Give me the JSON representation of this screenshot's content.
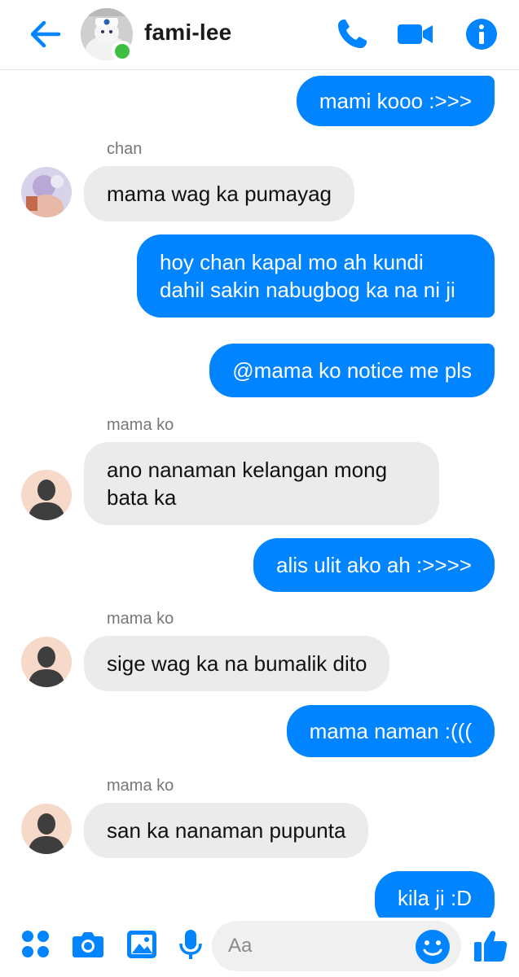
{
  "header": {
    "title": "fami-lee",
    "back_icon": "arrow-left-icon",
    "call_icon": "phone-icon",
    "video_icon": "video-camera-icon",
    "info_icon": "info-icon",
    "accent_color": "#0084ff",
    "online_color": "#3fbf3f"
  },
  "messages": [
    {
      "type": "out",
      "text": "mami kooo :>>>"
    },
    {
      "type": "in",
      "sender": "chan",
      "text": "mama wag ka pumayag"
    },
    {
      "type": "out",
      "text": "hoy chan kapal mo ah kundi dahil sakin nabugbog ka na ni ji"
    },
    {
      "type": "out",
      "text": "@mama ko notice me pls"
    },
    {
      "type": "in",
      "sender": "mama ko",
      "text": "ano nanaman kelangan mong bata ka"
    },
    {
      "type": "out",
      "text": "alis ulit ako ah :>>>>"
    },
    {
      "type": "in",
      "sender": "mama ko",
      "text": "sige wag ka na bumalik dito"
    },
    {
      "type": "out",
      "text": "mama naman :((("
    },
    {
      "type": "in",
      "sender": "mama ko",
      "text": "san ka nanaman pupunta"
    },
    {
      "type": "out",
      "text": "kila ji :D"
    }
  ],
  "composer": {
    "placeholder": "Aa",
    "apps_icon": "four-dots-menu-icon",
    "camera_icon": "camera-icon",
    "gallery_icon": "image-icon",
    "mic_icon": "microphone-icon",
    "emoji_icon": "smiley-icon",
    "like_icon": "thumbs-up-icon"
  }
}
